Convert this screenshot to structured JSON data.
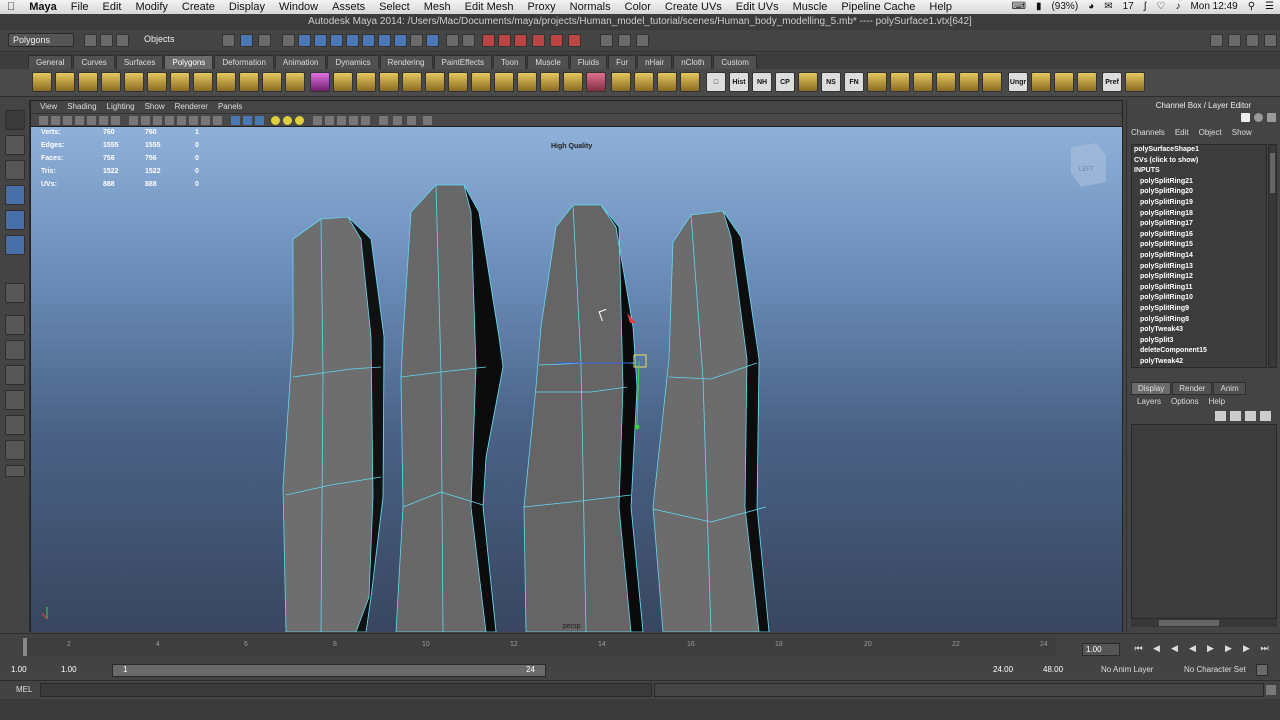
{
  "mac_menu": {
    "apple_icon": "apple-icon",
    "items": [
      "Maya",
      "File",
      "Edit",
      "Modify",
      "Create",
      "Display",
      "Window",
      "Assets",
      "Select",
      "Mesh",
      "Edit Mesh",
      "Proxy",
      "Normals",
      "Color",
      "Create UVs",
      "Edit UVs",
      "Muscle",
      "Pipeline Cache",
      "Help"
    ],
    "battery": "(93%)",
    "status_count": "17",
    "clock": "Mon 12:49"
  },
  "window_title": "Autodesk Maya 2014: /Users/Mac/Documents/maya/projects/Human_model_tutorial/scenes/Human_body_modelling_5.mb*   ----   polySurface1.vtx[642]",
  "status_line": {
    "menu_set": "Polygons",
    "selection_mode": "Objects"
  },
  "shelf_tabs": [
    "General",
    "Curves",
    "Surfaces",
    "Polygons",
    "Deformation",
    "Animation",
    "Dynamics",
    "Rendering",
    "PaintEffects",
    "Toon",
    "Muscle",
    "Fluids",
    "Fur",
    "nHair",
    "nCloth",
    "Custom"
  ],
  "shelf_active_tab": "Polygons",
  "shelf_text_icons": [
    "Hist",
    "NH",
    "CP",
    "NS",
    "FN",
    "Ungr",
    "Pref"
  ],
  "viewport": {
    "menu": [
      "View",
      "Shading",
      "Lighting",
      "Show",
      "Renderer",
      "Panels"
    ],
    "quality_label": "High Quality",
    "hud": [
      {
        "label": "Verts:",
        "a": "760",
        "b": "760",
        "c": "1"
      },
      {
        "label": "Edges:",
        "a": "1555",
        "b": "1555",
        "c": "0"
      },
      {
        "label": "Faces:",
        "a": "756",
        "b": "756",
        "c": "0"
      },
      {
        "label": "Tris:",
        "a": "1522",
        "b": "1522",
        "c": "0"
      },
      {
        "label": "UVs:",
        "a": "888",
        "b": "888",
        "c": "0"
      }
    ],
    "camera_label": "persp",
    "viewcube_label": "LEFT"
  },
  "channel_box": {
    "title": "Channel Box / Layer Editor",
    "menu": [
      "Channels",
      "Edit",
      "Object",
      "Show"
    ],
    "shape_name": "polySurfaceShape1",
    "cvs_label": "CVs (click to show)",
    "inputs_label": "INPUTS",
    "inputs": [
      "polySplitRing21",
      "polySplitRing20",
      "polySplitRing19",
      "polySplitRing18",
      "polySplitRing17",
      "polySplitRing16",
      "polySplitRing15",
      "polySplitRing14",
      "polySplitRing13",
      "polySplitRing12",
      "polySplitRing11",
      "polySplitRing10",
      "polySplitRing9",
      "polySplitRing8",
      "polyTweak43",
      "polySplit3",
      "deleteComponent15",
      "polyTweak42"
    ]
  },
  "layer_editor": {
    "tabs": [
      "Display",
      "Render",
      "Anim"
    ],
    "active_tab": "Display",
    "menu": [
      "Layers",
      "Options",
      "Help"
    ]
  },
  "time_slider": {
    "ticks": [
      "2",
      "4",
      "6",
      "8",
      "10",
      "12",
      "14",
      "16",
      "18",
      "20",
      "22",
      "24"
    ],
    "current_frame": "1.00"
  },
  "range_slider": {
    "start_time": "1.00",
    "range_start": "1.00",
    "range_marker_left": "1",
    "range_marker_right": "24",
    "range_end": "24.00",
    "end_time": "48.00",
    "anim_layer": "No Anim Layer",
    "character_set": "No Character Set"
  },
  "command_line": {
    "label": "MEL"
  }
}
